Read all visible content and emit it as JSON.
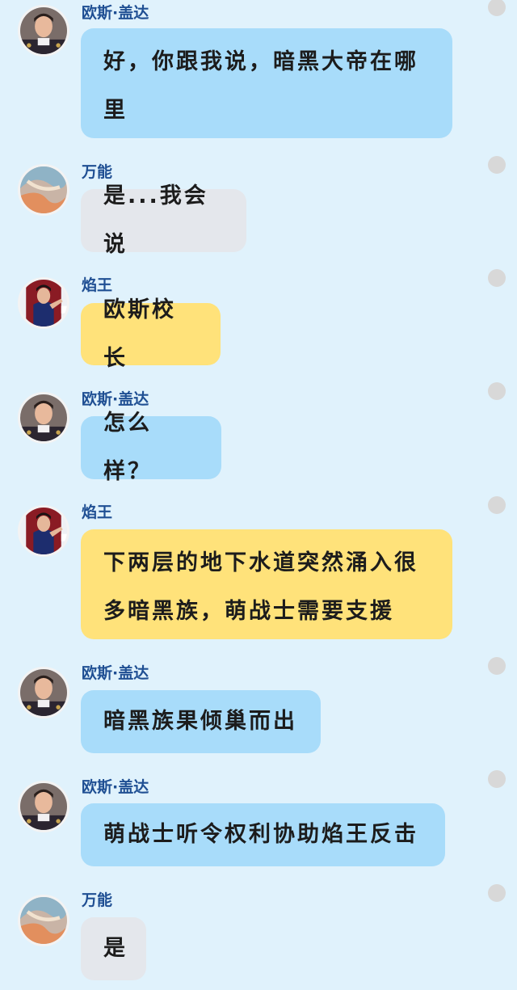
{
  "messages": [
    {
      "sender": "欧斯·盖达",
      "avatar": "oscar-avatar",
      "color": "blue",
      "text": "好，你跟我说，暗黑大帝在哪里"
    },
    {
      "sender": "万能",
      "avatar": "wanneng-avatar",
      "color": "gray",
      "text": "是...我会说"
    },
    {
      "sender": "焰王",
      "avatar": "yanwang-avatar",
      "color": "yellow",
      "text": "欧斯校长"
    },
    {
      "sender": "欧斯·盖达",
      "avatar": "oscar-avatar",
      "color": "blue",
      "text": "怎么样？"
    },
    {
      "sender": "焰王",
      "avatar": "yanwang-avatar",
      "color": "yellow",
      "text": "下两层的地下水道突然涌入很多暗黑族，萌战士需要支援"
    },
    {
      "sender": "欧斯·盖达",
      "avatar": "oscar-avatar",
      "color": "blue",
      "text": "暗黑族果倾巢而出"
    },
    {
      "sender": "欧斯·盖达",
      "avatar": "oscar-avatar",
      "color": "blue",
      "text": "萌战士听令权利协助焰王反击"
    },
    {
      "sender": "万能",
      "avatar": "wanneng-avatar",
      "color": "gray",
      "text": "是"
    }
  ],
  "colors": {
    "background": "#e0f2fc",
    "bubble_blue": "#a8dcfa",
    "bubble_gray": "#e4e7ec",
    "bubble_yellow": "#ffe27a",
    "sender_name": "#1f4f93",
    "menu_dot": "#d8d8d8"
  }
}
